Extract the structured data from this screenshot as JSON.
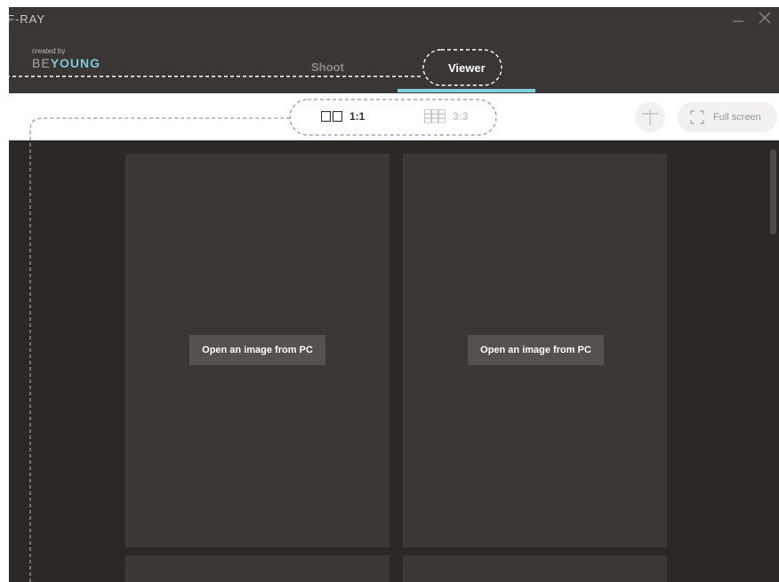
{
  "app": {
    "title": "F-RAY",
    "brand_created": "created by",
    "brand_be": "BE",
    "brand_young": "YOUNG"
  },
  "tabs": {
    "shoot": "Shoot",
    "viewer": "Viewer",
    "active": "Viewer"
  },
  "toolbar": {
    "layout_1x1": "1:1",
    "layout_3x3": "3:3",
    "layout_active": "1:1",
    "fullscreen_label": "Full screen"
  },
  "viewer": {
    "panels": [
      {
        "button_label": "Open an image from PC"
      },
      {
        "button_label": "Open an image from PC"
      }
    ]
  },
  "colors": {
    "accent": "#7fd0da",
    "header_bg": "#3a3634",
    "viewer_bg": "#2a2725",
    "panel_bg": "#3b3735",
    "button_bg": "#55514e"
  },
  "icons": [
    "minimize-icon",
    "close-icon",
    "layout-1x1-icon",
    "layout-3x3-icon",
    "crosshair-icon",
    "fullscreen-icon"
  ]
}
